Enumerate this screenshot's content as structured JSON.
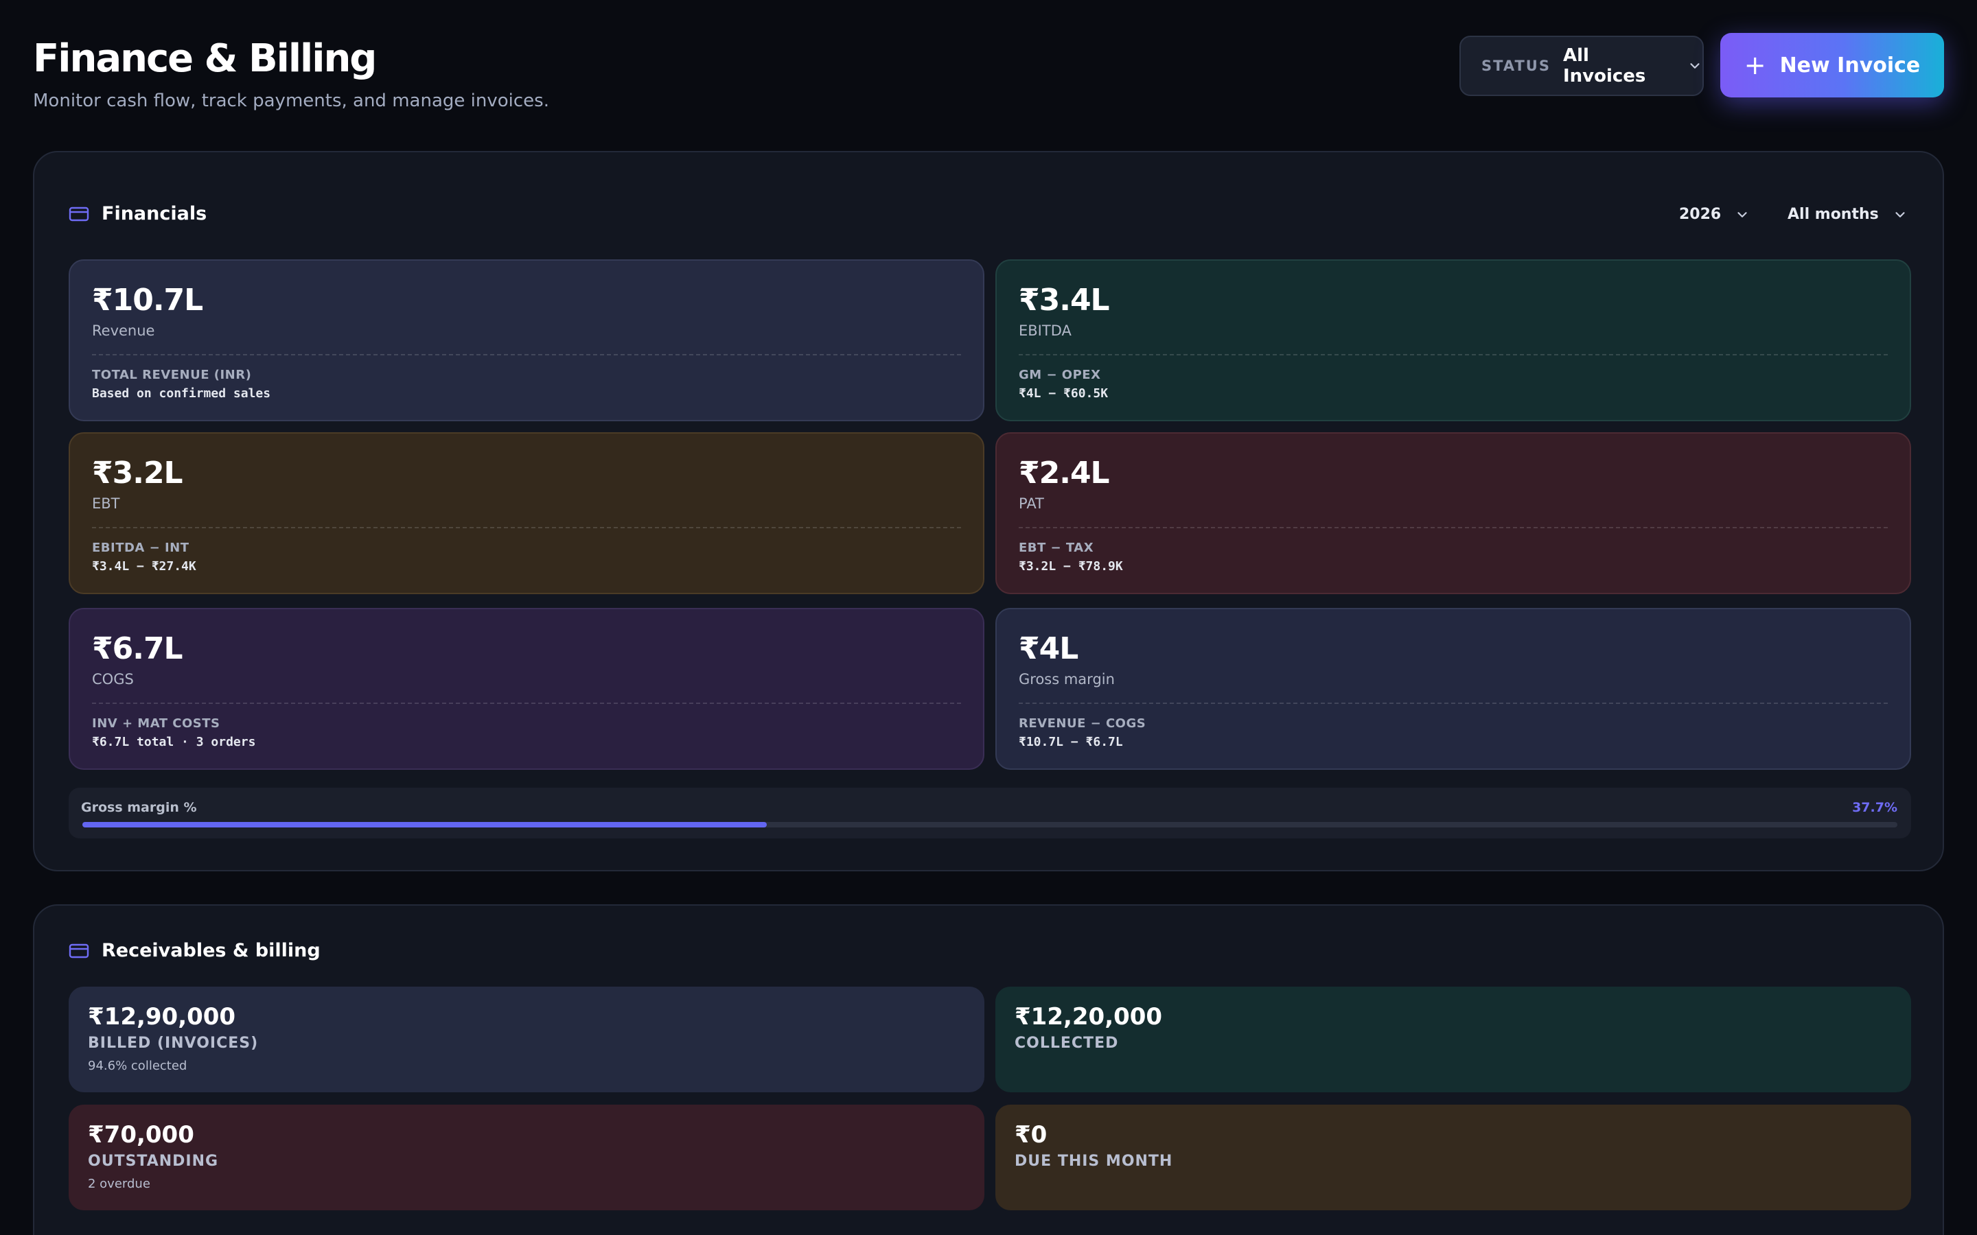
{
  "header": {
    "title": "Finance & Billing",
    "subtitle": "Monitor cash flow, track payments, and manage invoices.",
    "status_label": "STATUS",
    "status_value": "All Invoices",
    "new_invoice_plus": "+",
    "new_invoice_label": "New Invoice"
  },
  "financials": {
    "title": "Financials",
    "year": "2026",
    "months": "All months",
    "cards": [
      {
        "value": "₹10.7L",
        "label": "Revenue",
        "formula_label": "TOTAL REVENUE (INR)",
        "formula_value": "Based on confirmed sales"
      },
      {
        "value": "₹3.4L",
        "label": "EBITDA",
        "formula_label": "GM − OPEX",
        "formula_value": "₹4L − ₹60.5K"
      },
      {
        "value": "₹3.2L",
        "label": "EBT",
        "formula_label": "EBITDA − INT",
        "formula_value": "₹3.4L − ₹27.4K"
      },
      {
        "value": "₹2.4L",
        "label": "PAT",
        "formula_label": "EBT − TAX",
        "formula_value": "₹3.2L − ₹78.9K"
      },
      {
        "value": "₹6.7L",
        "label": "COGS",
        "formula_label": "INV + MAT COSTS",
        "formula_value": "₹6.7L total · 3 orders"
      },
      {
        "value": "₹4L",
        "label": "Gross margin",
        "formula_label": "REVENUE − COGS",
        "formula_value": "₹10.7L − ₹6.7L"
      }
    ],
    "gross_margin": {
      "label": "Gross margin %",
      "value_text": "37.7%",
      "fill_fraction": 0.377
    }
  },
  "receivables": {
    "title": "Receivables & billing",
    "cards": [
      {
        "value": "₹12,90,000",
        "label": "BILLED (INVOICES)",
        "sub": "94.6% collected"
      },
      {
        "value": "₹12,20,000",
        "label": "COLLECTED",
        "sub": ""
      },
      {
        "value": "₹70,000",
        "label": "OUTSTANDING",
        "sub": "2 overdue"
      },
      {
        "value": "₹0",
        "label": "DUE THIS MONTH",
        "sub": ""
      }
    ]
  },
  "colors": {
    "accent": "#6366f1",
    "button_gradient_start": "#7b5cf6",
    "button_gradient_end": "#19b0d8",
    "background": "#090b11"
  },
  "icons": {
    "section": "credit-card-icon",
    "dropdown": "chevron-down-icon",
    "add": "plus-icon"
  }
}
